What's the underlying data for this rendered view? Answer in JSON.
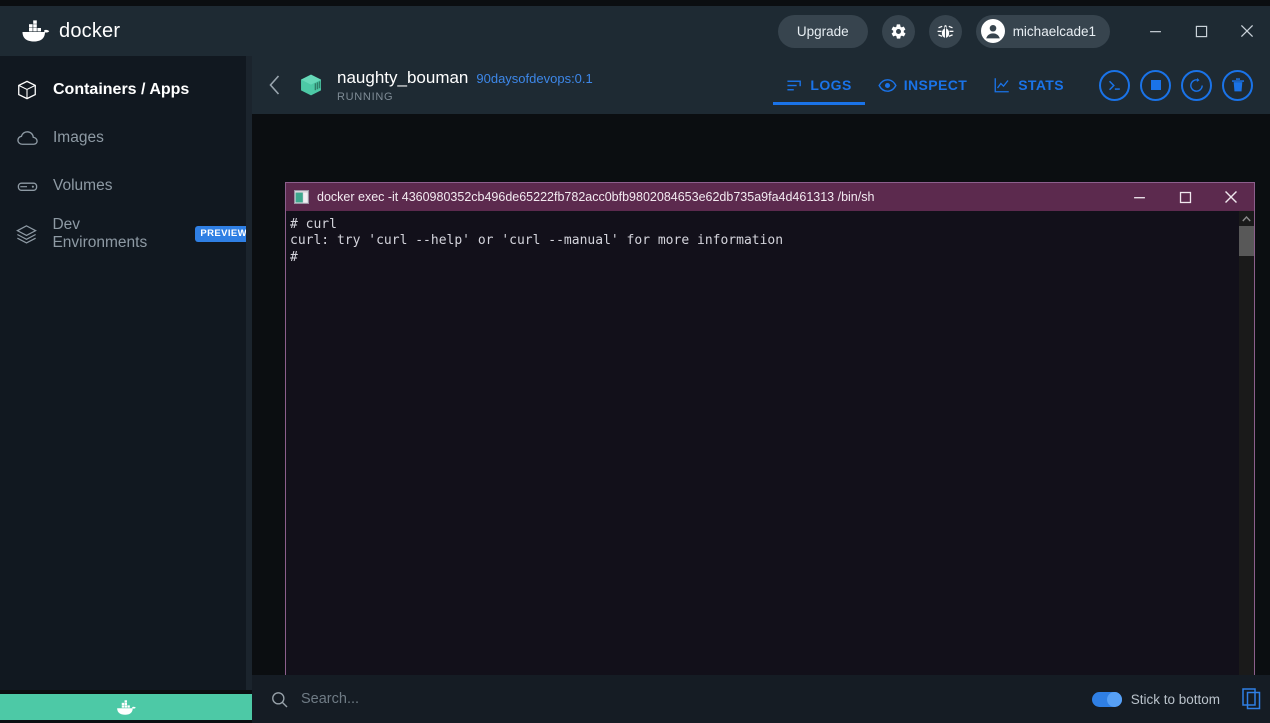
{
  "window": {
    "brand": "docker",
    "upgrade_label": "Upgrade",
    "user_name": "michaelcade1",
    "controls": {
      "minimize": "minimize-icon",
      "maximize": "maximize-icon",
      "close": "close-icon"
    },
    "icons": {
      "gear": "gear-icon",
      "bug": "bug-icon",
      "avatar": "avatar-icon",
      "whale": "docker-whale-icon"
    }
  },
  "sidebar": {
    "items": [
      {
        "label": "Containers / Apps",
        "icon": "container-icon",
        "active": true,
        "badge": ""
      },
      {
        "label": "Images",
        "icon": "images-cloud-icon",
        "active": false,
        "badge": ""
      },
      {
        "label": "Volumes",
        "icon": "volumes-icon",
        "active": false,
        "badge": ""
      },
      {
        "label": "Dev Environments",
        "icon": "dev-environments-icon",
        "active": false,
        "badge": "PREVIEW"
      }
    ]
  },
  "container": {
    "name": "naughty_bouman",
    "image": "90daysofdevops:0.1",
    "status": "RUNNING",
    "icon": "container-cube-icon",
    "back_icon": "chevron-left-icon"
  },
  "tabs": [
    {
      "label": "LOGS",
      "icon": "logs-icon",
      "active": true
    },
    {
      "label": "INSPECT",
      "icon": "eye-icon",
      "active": false
    },
    {
      "label": "STATS",
      "icon": "chart-icon",
      "active": false
    }
  ],
  "actions": [
    {
      "name": "cli-button",
      "icon": "terminal-prompt-icon"
    },
    {
      "name": "stop-button",
      "icon": "stop-square-icon"
    },
    {
      "name": "restart-button",
      "icon": "restart-arrow-icon"
    },
    {
      "name": "delete-button",
      "icon": "trash-icon"
    }
  ],
  "terminal": {
    "title": "docker exec -it 4360980352cb496de65222fb782acc0bfb9802084653e62db735a9fa4d461313 /bin/sh",
    "icon": "terminal-window-icon",
    "lines": [
      "# curl",
      "curl: try 'curl --help' or 'curl --manual' for more information",
      "#"
    ],
    "controls": {
      "minimize": "minimize-icon",
      "maximize": "maximize-icon",
      "close": "close-icon"
    },
    "scroll": {
      "up": "scroll-up-arrow-icon",
      "down": "scroll-down-arrow-icon"
    }
  },
  "bottom": {
    "search_placeholder": "Search...",
    "search_value": "",
    "search_icon": "search-icon",
    "stick_label": "Stick to bottom",
    "stick_enabled": true,
    "copy_icon": "copy-icon"
  },
  "colors": {
    "accent_blue": "#1a73e8",
    "link_blue": "#3d87e8",
    "titlebar": "#1e2a33",
    "sidebar": "#111820",
    "content_bg": "#0b0e11",
    "terminal_title": "#5c2a4e",
    "terminal_bg": "#12101a",
    "status_green": "#4dc9a6",
    "badge_blue": "#2f7fe4"
  }
}
